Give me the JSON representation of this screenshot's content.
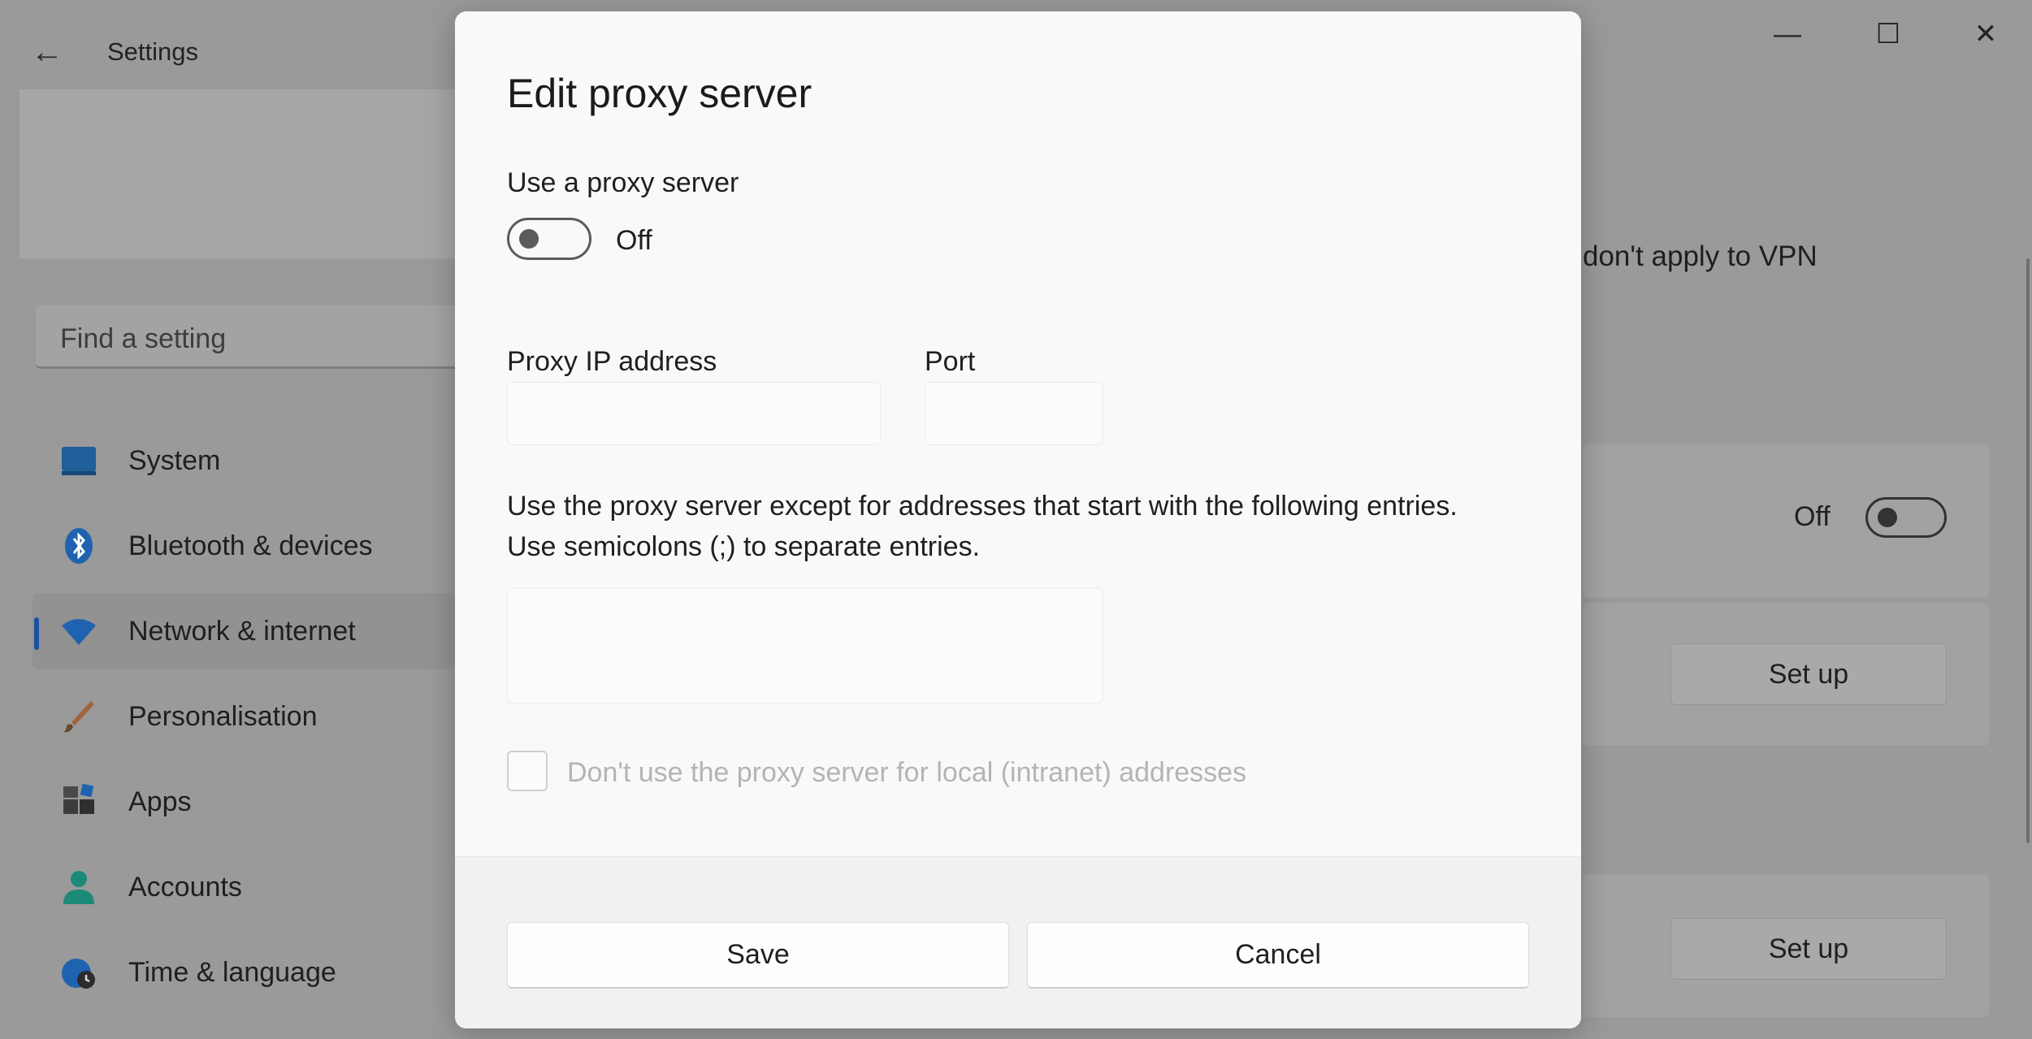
{
  "app": {
    "title": "Settings",
    "search_placeholder": "Find a setting",
    "nav": [
      {
        "label": "System",
        "icon": "system-icon"
      },
      {
        "label": "Bluetooth & devices",
        "icon": "bluetooth-icon"
      },
      {
        "label": "Network & internet",
        "icon": "wifi-icon",
        "selected": true
      },
      {
        "label": "Personalisation",
        "icon": "brush-icon"
      },
      {
        "label": "Apps",
        "icon": "apps-icon"
      },
      {
        "label": "Accounts",
        "icon": "person-icon"
      },
      {
        "label": "Time & language",
        "icon": "globe-clock-icon"
      }
    ]
  },
  "content": {
    "note_partial": "don't apply to VPN",
    "toggle_state": "Off",
    "setup_buttons": [
      "Set up",
      "Set up"
    ]
  },
  "dialog": {
    "title": "Edit proxy server",
    "use_proxy_label": "Use a proxy server",
    "use_proxy_state": "Off",
    "use_proxy_on": false,
    "ip_label": "Proxy IP address",
    "ip_value": "",
    "port_label": "Port",
    "port_value": "",
    "exceptions_line1": "Use the proxy server except for addresses that start with the following entries.",
    "exceptions_line2": "Use semicolons (;) to separate entries.",
    "exceptions_value": "",
    "local_bypass_label": "Don't use the proxy server for local (intranet) addresses",
    "local_bypass_checked": false,
    "save_label": "Save",
    "cancel_label": "Cancel"
  },
  "colors": {
    "accent": "#1a4fa0",
    "dim_background": "#9a9a9a",
    "dialog_background": "#f9f9f9"
  }
}
